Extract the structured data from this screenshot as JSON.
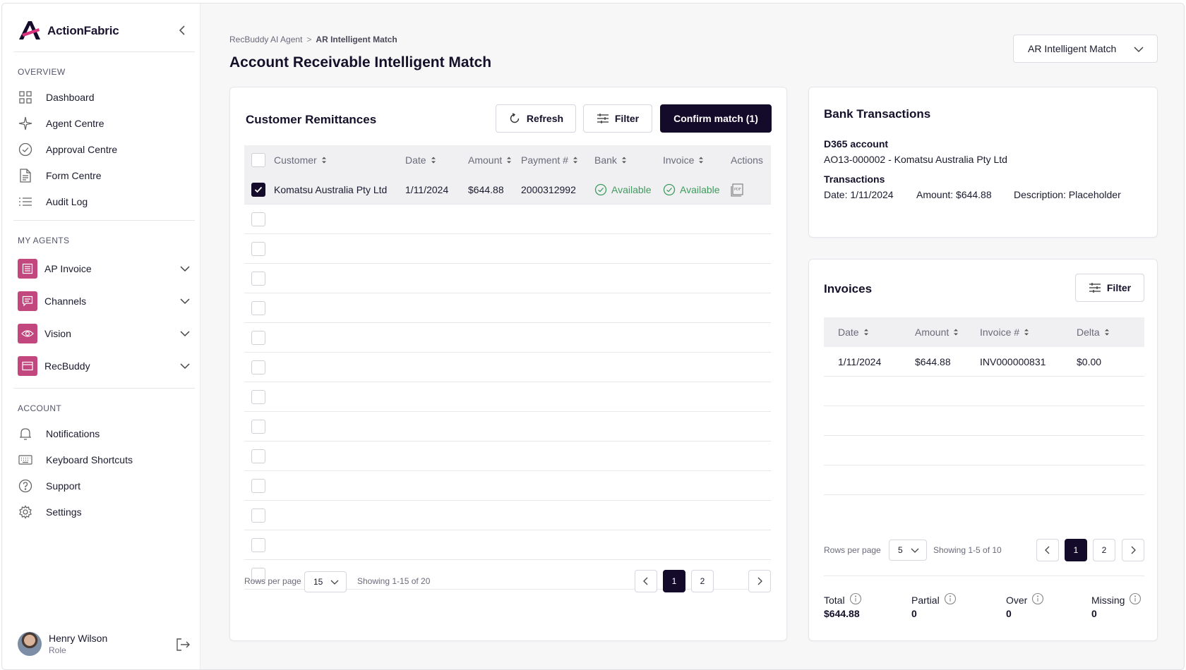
{
  "brand": {
    "name": "ActionFabric"
  },
  "sidebar": {
    "overview_heading": "OVERVIEW",
    "overview": [
      {
        "label": "Dashboard",
        "icon": "grid-icon"
      },
      {
        "label": "Agent Centre",
        "icon": "sparkle-icon"
      },
      {
        "label": "Approval Centre",
        "icon": "check-circle-icon"
      },
      {
        "label": "Form Centre",
        "icon": "document-icon"
      },
      {
        "label": "Audit Log",
        "icon": "list-icon"
      }
    ],
    "agents_heading": "MY AGENTS",
    "agents": [
      {
        "label": "AP Invoice",
        "icon": "invoice-icon"
      },
      {
        "label": "Channels",
        "icon": "chat-icon"
      },
      {
        "label": "Vision",
        "icon": "eye-icon"
      },
      {
        "label": "RecBuddy",
        "icon": "card-icon"
      }
    ],
    "account_heading": "ACCOUNT",
    "account": [
      {
        "label": "Notifications",
        "icon": "bell-icon"
      },
      {
        "label": "Keyboard Shortcuts",
        "icon": "keyboard-icon"
      },
      {
        "label": "Support",
        "icon": "help-icon"
      },
      {
        "label": "Settings",
        "icon": "gear-icon"
      }
    ],
    "user": {
      "name": "Henry Wilson",
      "role": "Role"
    }
  },
  "header": {
    "breadcrumb_parent": "RecBuddy AI Agent",
    "breadcrumb_current": "AR Intelligent Match",
    "title": "Account Receivable Intelligent Match",
    "agent_select": "AR Intelligent Match"
  },
  "remittances": {
    "title": "Customer Remittances",
    "refresh_label": "Refresh",
    "filter_label": "Filter",
    "confirm_label": "Confirm match (1)",
    "columns": [
      "Customer",
      "Date",
      "Amount",
      "Payment #",
      "Bank",
      "Invoice",
      "Actions"
    ],
    "rows": [
      {
        "customer": "Komatsu Australia Pty Ltd",
        "date": "1/11/2024",
        "amount": "$644.88",
        "payment": "2000312992",
        "bank": "Available",
        "invoice": "Available",
        "checked": true
      }
    ],
    "empty_rows": 13,
    "rows_per_page_label": "Rows per page",
    "rows_per_page": "15",
    "showing": "Showing 1-15 of 20",
    "pages": [
      "1",
      "2"
    ]
  },
  "bank": {
    "title": "Bank Transactions",
    "account_label": "D365 account",
    "account_value": "AO13-000002 - Komatsu Australia Pty Ltd",
    "transactions_label": "Transactions",
    "date_text": "Date: 1/11/2024",
    "amount_text": "Amount: $644.88",
    "description_text": "Description: Placeholder"
  },
  "invoices": {
    "title": "Invoices",
    "filter_label": "Filter",
    "columns": [
      "Date",
      "Amount",
      "Invoice #",
      "Delta"
    ],
    "rows": [
      {
        "date": "1/11/2024",
        "amount": "$644.88",
        "invoice": "INV000000831",
        "delta": "$0.00"
      }
    ],
    "rows_per_page_label": "Rows per page",
    "rows_per_page": "5",
    "showing": "Showing 1-5 of 10",
    "pages": [
      "1",
      "2"
    ],
    "summary": [
      {
        "label": "Total",
        "value": "$644.88"
      },
      {
        "label": "Partial",
        "value": "0"
      },
      {
        "label": "Over",
        "value": "0"
      },
      {
        "label": "Missing",
        "value": "0"
      }
    ]
  }
}
